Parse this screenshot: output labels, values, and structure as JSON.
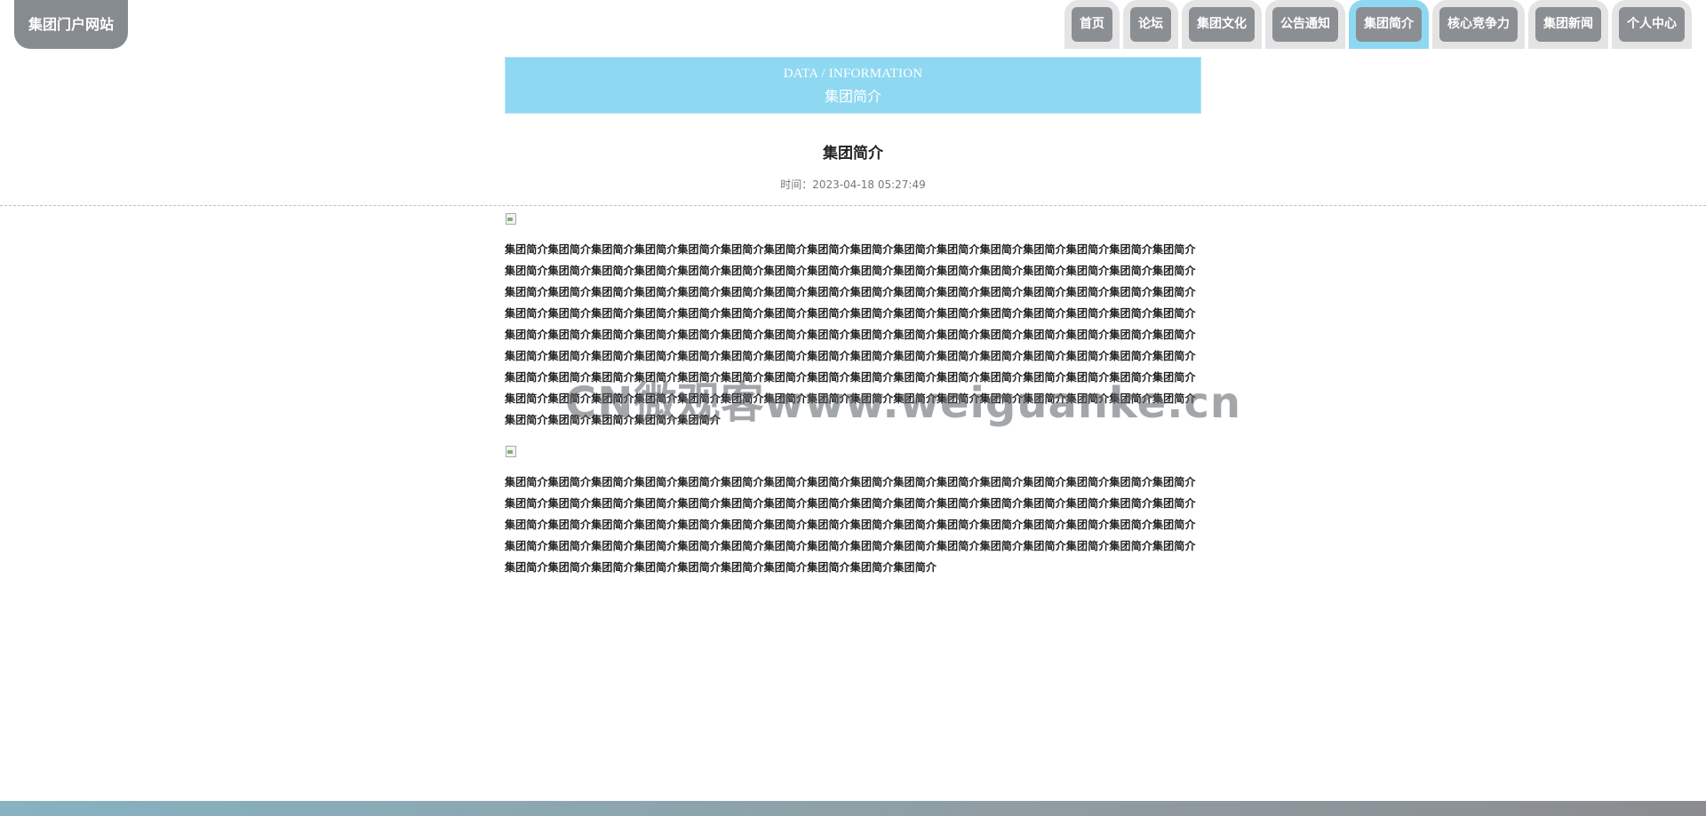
{
  "site": {
    "logo_text": "集团门户网站"
  },
  "nav": {
    "items": [
      {
        "label": "首页"
      },
      {
        "label": "论坛"
      },
      {
        "label": "集团文化"
      },
      {
        "label": "公告通知"
      },
      {
        "label": "集团简介",
        "active": true
      },
      {
        "label": "核心竞争力"
      },
      {
        "label": "集团新闻"
      },
      {
        "label": "个人中心"
      }
    ]
  },
  "banner": {
    "subtitle_en": "DATA / INFORMATION",
    "title_cn": "集团简介"
  },
  "article": {
    "title": "集团简介",
    "time": "时间：2023-04-18 05:27:49",
    "paragraph1": "集团简介集团简介集团简介集团简介集团简介集团简介集团简介集团简介集团简介集团简介集团简介集团简介集团简介集团简介集团简介集团简介集团简介集团简介集团简介集团简介集团简介集团简介集团简介集团简介集团简介集团简介集团简介集团简介集团简介集团简介集团简介集团简介集团简介集团简介集团简介集团简介集团简介集团简介集团简介集团简介集团简介集团简介集团简介集团简介集团简介集团简介集团简介集团简介集团简介集团简介集团简介集团简介集团简介集团简介集团简介集团简介集团简介集团简介集团简介集团简介集团简介集团简介集团简介集团简介集团简介集团简介集团简介集团简介集团简介集团简介集团简介集团简介集团简介集团简介集团简介集团简介集团简介集团简介集团简介集团简介集团简介集团简介集团简介集团简介集团简介集团简介集团简介集团简介集团简介集团简介集团简介集团简介集团简介集团简介集团简介集团简介集团简介集团简介集团简介集团简介集团简介集团简介集团简介集团简介集团简介集团简介集团简介集团简介集团简介集团简介集团简介集团简介集团简介集团简介集团简介集团简介集团简介集团简介集团简介集团简介集团简介集团简介集团简介集团简介集团简介集团简介集团简介集团简介集团简介集团简介集团简介集团简介集团简介",
    "paragraph2": "集团简介集团简介集团简介集团简介集团简介集团简介集团简介集团简介集团简介集团简介集团简介集团简介集团简介集团简介集团简介集团简介集团简介集团简介集团简介集团简介集团简介集团简介集团简介集团简介集团简介集团简介集团简介集团简介集团简介集团简介集团简介集团简介集团简介集团简介集团简介集团简介集团简介集团简介集团简介集团简介集团简介集团简介集团简介集团简介集团简介集团简介集团简介集团简介集团简介集团简介集团简介集团简介集团简介集团简介集团简介集团简介集团简介集团简介集团简介集团简介集团简介集团简介集团简介集团简介集团简介集团简介集团简介集团简介集团简介集团简介集团简介集团简介集团简介集团简介"
  },
  "watermark": {
    "text": "CN微观客www.weiguanke.cn"
  },
  "colors": {
    "accent": "#8fd8f2",
    "nav_tab": "#8b8f93",
    "nav_tab_outer": "#e4e4e4",
    "logo_bg": "#868b8f"
  },
  "icons": {
    "broken_image": "broken-image-icon"
  }
}
